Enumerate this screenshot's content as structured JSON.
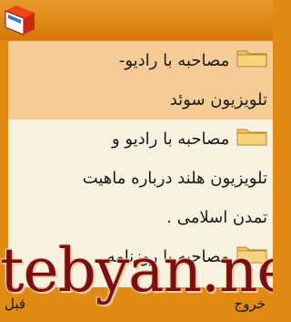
{
  "list": {
    "items": [
      {
        "line1": "مصاحبه با رادیو-",
        "line2": "تلویزیون سوئد",
        "line3": ""
      },
      {
        "line1": "مصاحبه با رادیو و",
        "line2": "تلویزیون هلند درباره ماهیت",
        "line3": "تمدن اسلامی ."
      },
      {
        "line1": "مصاحبه با روزنامه",
        "line2": "",
        "line3": ""
      }
    ],
    "selected_index": 0,
    "item_icon": "folder-icon"
  },
  "softkeys": {
    "left_label": "قبل",
    "right_label": "خروج"
  },
  "watermark": "tebyan.net",
  "colors": {
    "background": "#e08a12",
    "list_bg": "#f7f1e0",
    "selection": "#f6cc96",
    "watermark": "#7a0e10"
  }
}
